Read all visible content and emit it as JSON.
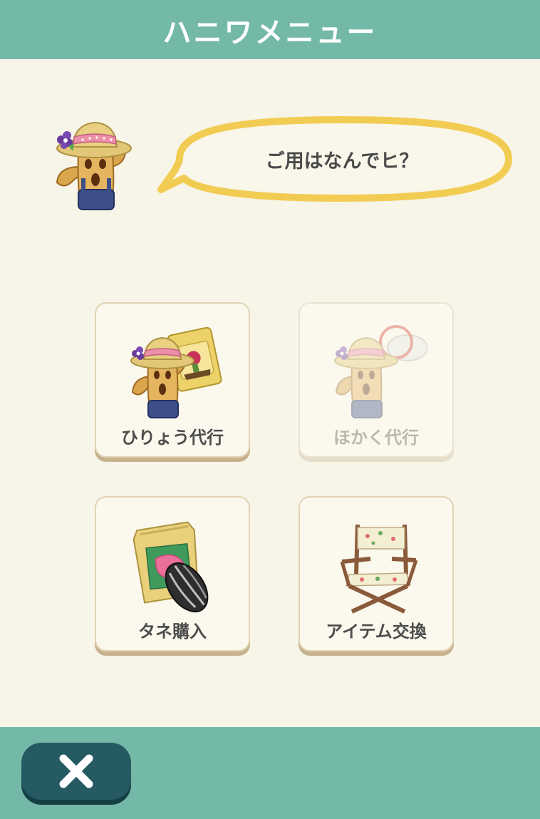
{
  "header": {
    "title": "ハニワメニュー"
  },
  "dialog": {
    "message": "ご用はなんでヒ？"
  },
  "menu": {
    "items": [
      {
        "label": "ひりょう代行",
        "icon": "haniwa-fertilizer-icon",
        "enabled": true
      },
      {
        "label": "ほかく代行",
        "icon": "haniwa-bug-net-icon",
        "enabled": false
      },
      {
        "label": "タネ購入",
        "icon": "seed-packet-icon",
        "enabled": true
      },
      {
        "label": "アイテム交換",
        "icon": "folding-chair-icon",
        "enabled": true
      }
    ]
  },
  "footer": {
    "close_icon": "close-icon"
  },
  "colors": {
    "header": "#74b9a8",
    "background": "#f7f4e8",
    "bubble_border": "#f2cc52",
    "close_button": "#255a63",
    "label_text": "#4c4c4c",
    "disabled_text": "#bdb8ad"
  }
}
